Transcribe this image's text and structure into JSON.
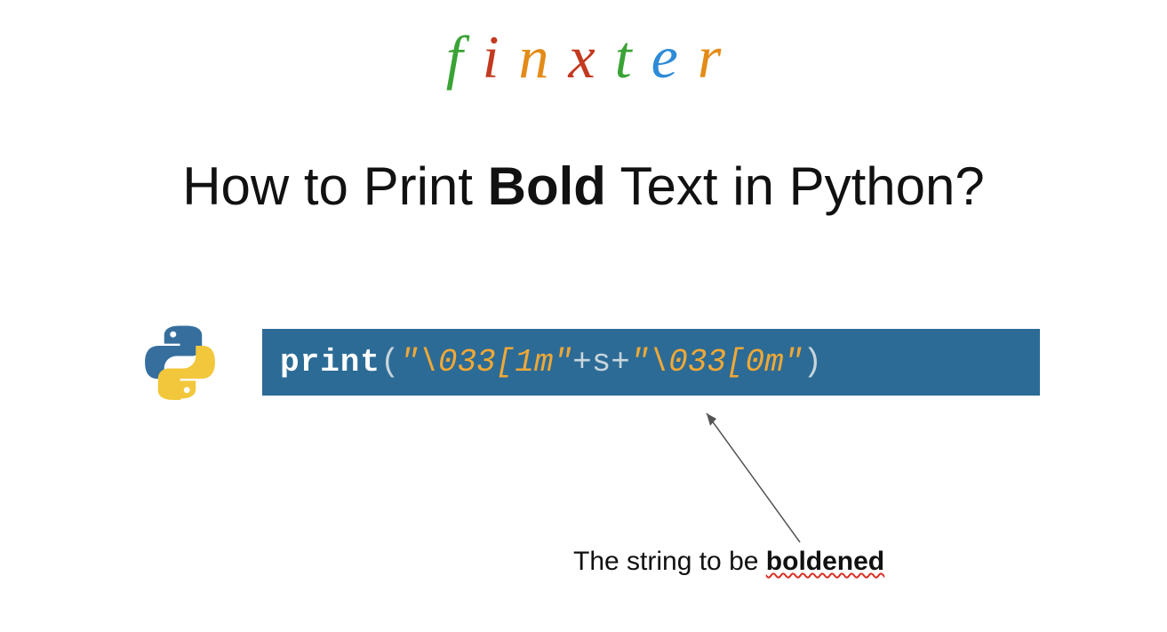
{
  "logo": {
    "letters": [
      "f",
      "i",
      "n",
      "x",
      "t",
      "e",
      "r"
    ]
  },
  "title": {
    "part1": "How to Print ",
    "bold": "Bold",
    "part2": " Text in Python?"
  },
  "code": {
    "fn": "print",
    "open": "(",
    "str1": "\"\\033[1m\"",
    "plus1": " + ",
    "var": "s",
    "plus2": " + ",
    "str2": "\"\\033[0m\"",
    "close": ")"
  },
  "annotation": {
    "part1": "The string to be ",
    "bold": "boldened"
  }
}
